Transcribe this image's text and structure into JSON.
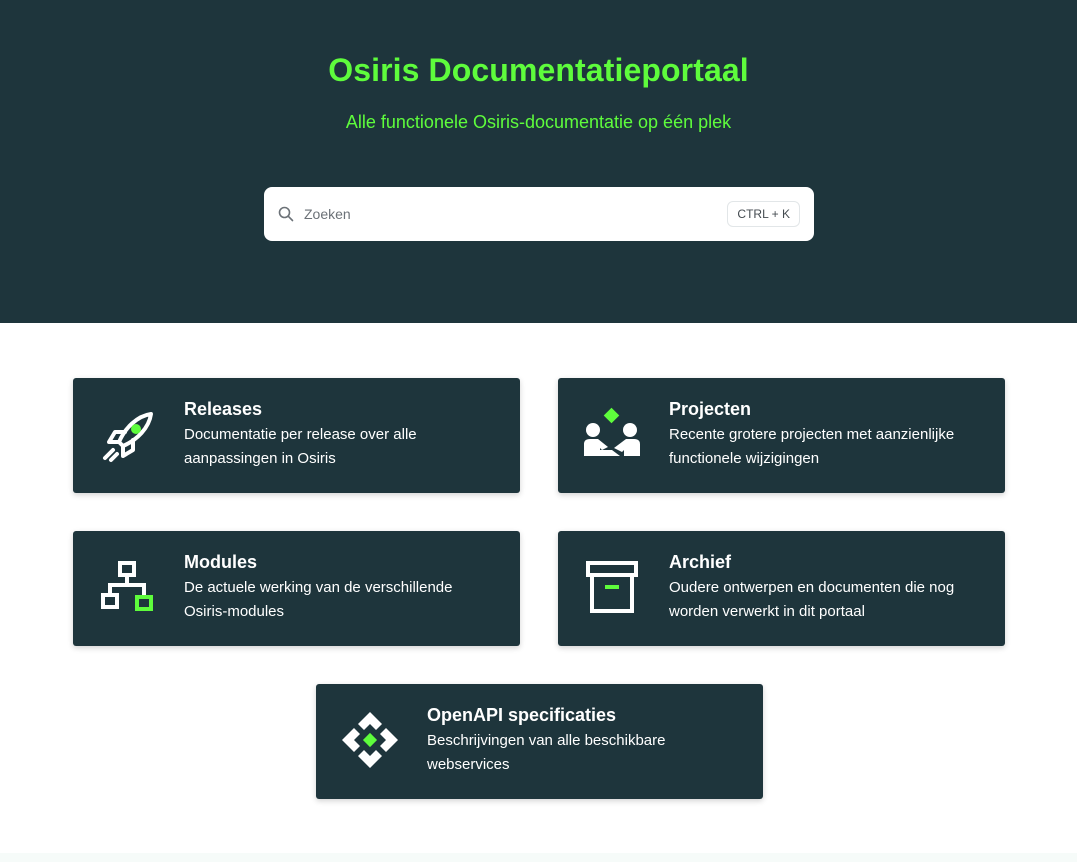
{
  "hero": {
    "title": "Osiris Documentatieportaal",
    "subtitle": "Alle functionele Osiris-documentatie op één plek"
  },
  "search": {
    "placeholder": "Zoeken",
    "shortcut": "CTRL + K",
    "icon": "search-icon"
  },
  "colors": {
    "primary_dark": "#1e353c",
    "accent_green": "#5efc3c",
    "card_text": "#ffffff"
  },
  "cards": [
    {
      "title": "Releases",
      "description": "Documentatie per release over alle aanpassingen in Osiris",
      "icon": "rocket-icon"
    },
    {
      "title": "Projecten",
      "description": "Recente grotere projecten met aanzienlijke functionele wijzigingen",
      "icon": "handshake-icon"
    },
    {
      "title": "Modules",
      "description": "De actuele werking van de verschillende Osiris-modules",
      "icon": "sitemap-icon"
    },
    {
      "title": "Archief",
      "description": "Oudere ontwerpen en documenten die nog worden verwerkt in dit portaal",
      "icon": "archive-box-icon"
    },
    {
      "title": "OpenAPI specificaties",
      "description": "Beschrijvingen van alle beschikbare webservices",
      "icon": "api-diamond-icon"
    }
  ]
}
